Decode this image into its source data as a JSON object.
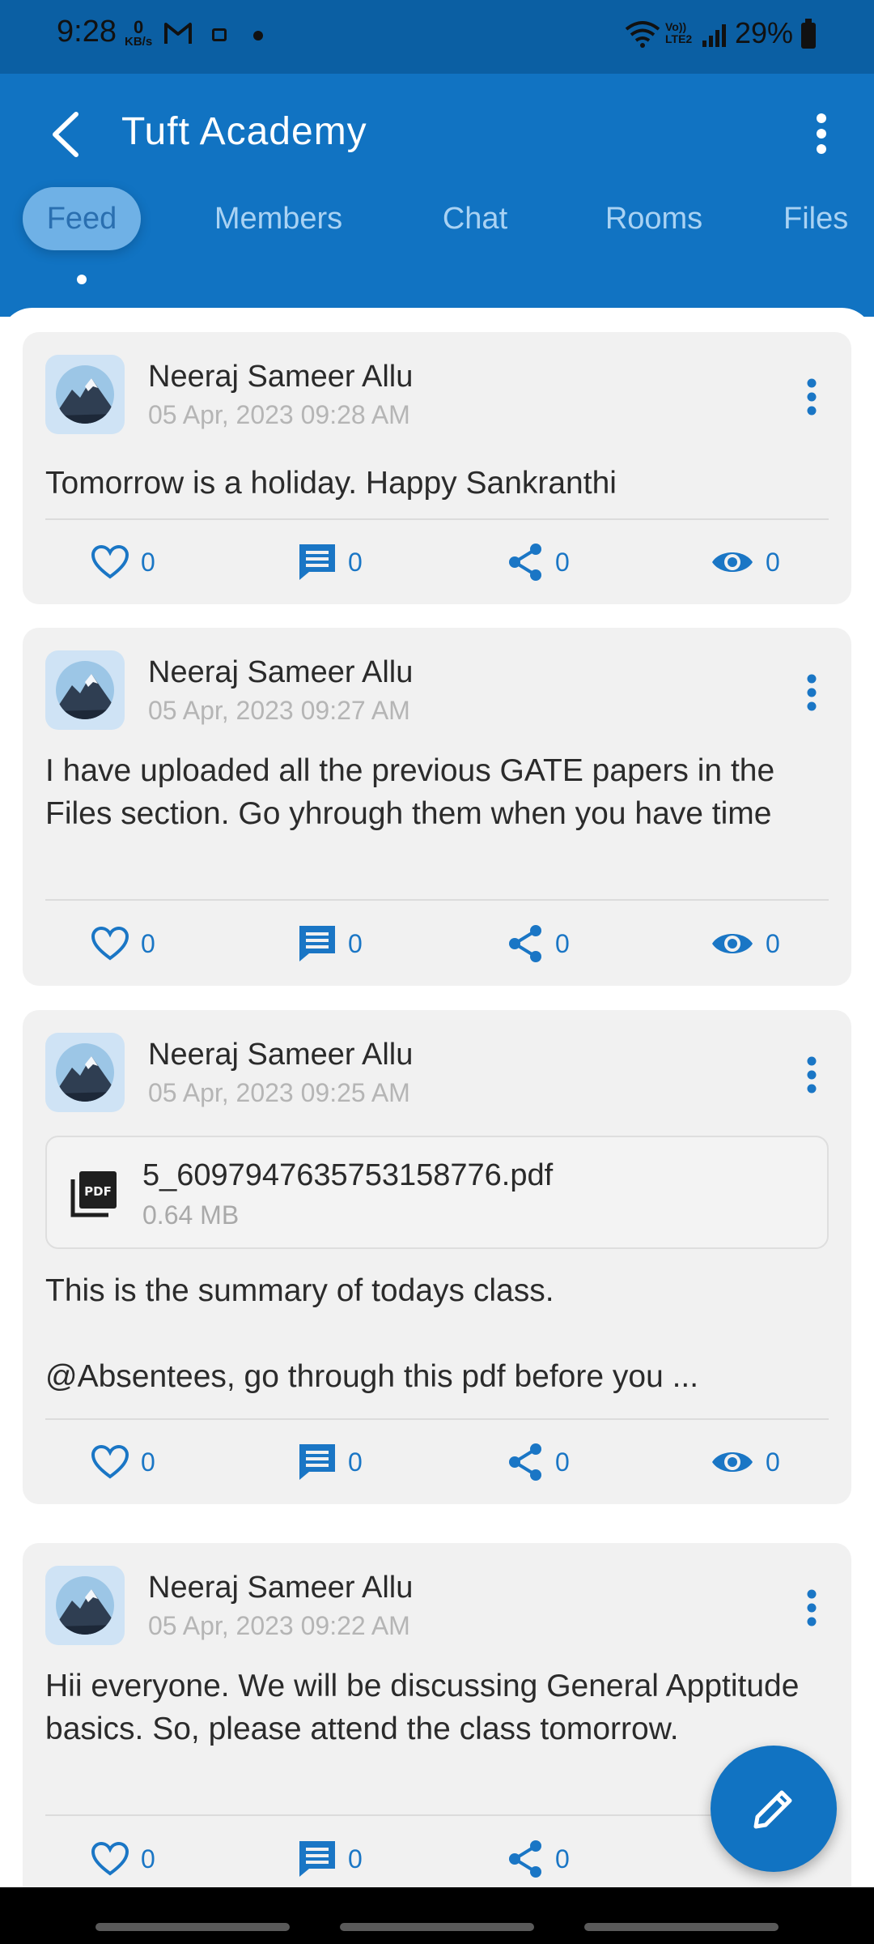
{
  "status_bar": {
    "time": "9:28",
    "net_speed_value": "0",
    "net_speed_unit": "KB/s",
    "volte": "Vo)) LTE2",
    "battery": "29%"
  },
  "header": {
    "title": "Tuft Academy",
    "back_icon": "back-arrow-icon",
    "menu_icon": "more-vert-icon"
  },
  "tabs": [
    {
      "label": "Feed",
      "active": true
    },
    {
      "label": "Members",
      "active": false
    },
    {
      "label": "Chat",
      "active": false
    },
    {
      "label": "Rooms",
      "active": false
    },
    {
      "label": "Files",
      "active": false
    }
  ],
  "posts": [
    {
      "author": "Neeraj Sameer Allu",
      "timestamp": "05 Apr, 2023 09:28 AM",
      "text": "Tomorrow is a holiday. Happy Sankranthi",
      "likes": "0",
      "comments": "0",
      "shares": "0",
      "views": "0"
    },
    {
      "author": "Neeraj Sameer Allu",
      "timestamp": "05 Apr, 2023 09:27 AM",
      "text": "I have uploaded all the previous GATE papers in the Files section. Go yhrough them when you have time",
      "likes": "0",
      "comments": "0",
      "shares": "0",
      "views": "0"
    },
    {
      "author": "Neeraj Sameer Allu",
      "timestamp": "05 Apr, 2023 09:25 AM",
      "attachment": {
        "filename": "5_6097947635753158776.pdf",
        "size": "0.64 MB"
      },
      "text_line1": "This is the summary of todays class.",
      "text_line2": "@Absentees, go through this pdf before you ...",
      "likes": "0",
      "comments": "0",
      "shares": "0",
      "views": "0"
    },
    {
      "author": "Neeraj Sameer Allu",
      "timestamp": "05 Apr, 2023 09:22 AM",
      "text": "Hii everyone. We will be discussing General Apptitude basics. So, please attend the class tomorrow.",
      "likes": "0",
      "comments": "0",
      "shares": "0"
    }
  ],
  "colors": {
    "primary": "#1173c2",
    "status_bar": "#0b5fa3",
    "card": "#f1f1f1",
    "accent_icon": "#1a76c5"
  },
  "fab_icon": "pencil-icon"
}
